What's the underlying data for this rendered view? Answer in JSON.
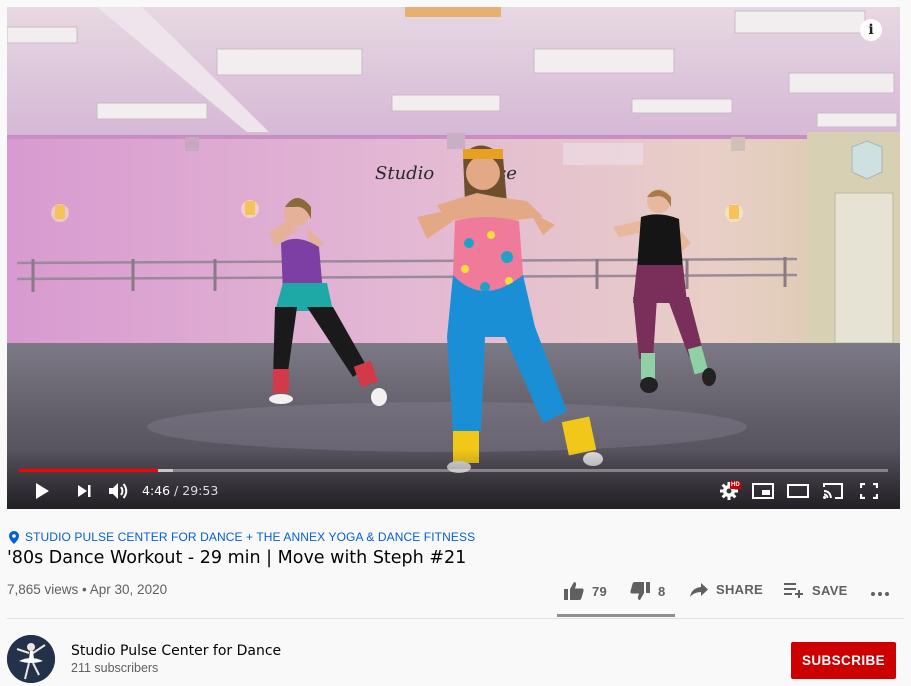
{
  "player": {
    "current_time": "4:46",
    "separator": " / ",
    "duration": "29:53",
    "progress_played": 0.16,
    "progress_buffered": 0.177,
    "hd_badge": "HD",
    "info_label": "i",
    "studio_sign": "Studio Pulse"
  },
  "video": {
    "location": "STUDIO PULSE CENTER FOR DANCE + THE ANNEX YOGA & DANCE FITNESS",
    "title": "'80s Dance Workout - 29 min | Move with Steph #21",
    "views": "7,865 views",
    "dot": " • ",
    "date": "Apr 30, 2020"
  },
  "actions": {
    "likes": "79",
    "dislikes": "8",
    "share_label": "SHARE",
    "save_label": "SAVE",
    "like_ratio": 0.9
  },
  "channel": {
    "name": "Studio Pulse Center for Dance",
    "subscribers": "211 subscribers",
    "subscribe_label": "SUBSCRIBE"
  },
  "colors": {
    "accent_red": "#cc0000",
    "progress_red": "#ff0000",
    "link_blue": "#065fd4"
  }
}
